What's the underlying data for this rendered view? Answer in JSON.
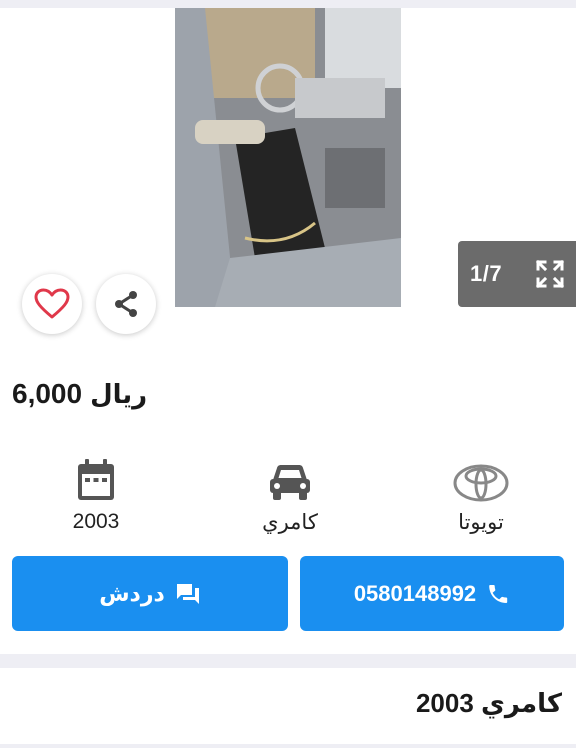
{
  "gallery": {
    "counter": "1/7",
    "prev_icon": "chevron-left-icon",
    "next_icon": "chevron-right-icon",
    "fullscreen_icon": "fullscreen-icon"
  },
  "actions": {
    "favorite_icon": "heart-outline-icon",
    "share_icon": "share-icon"
  },
  "listing": {
    "price_value": "6,000",
    "price_currency": "ريال",
    "title": "كامري 2003"
  },
  "specs": {
    "year": "2003",
    "model": "كامري",
    "make": "تويوتا"
  },
  "buttons": {
    "chat_label": "دردش",
    "phone_number": "0580148992"
  },
  "colors": {
    "primary_button": "#1a8ff0",
    "favorite_heart": "#e0384a",
    "counter_bg": "#6b6b6b",
    "section_bg": "#eeeef4"
  }
}
